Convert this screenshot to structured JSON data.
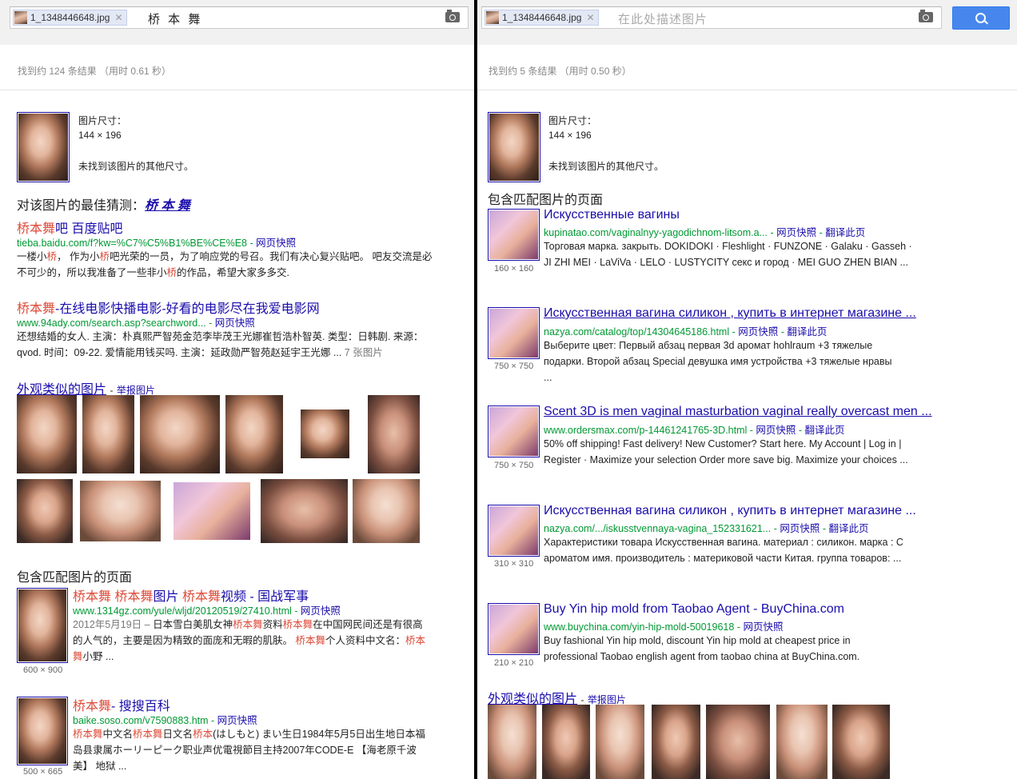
{
  "left": {
    "chip_filename": "1_1348446648.jpg",
    "query": "桥 本 舞",
    "stats": "找到约 124 条结果 （用时 0.61 秒）",
    "image_size_label": "图片尺寸：",
    "image_size": "144 × 196",
    "no_other_sizes": "未找到该图片的其他尺寸。",
    "best_guess_label": "对该图片的最佳猜测：",
    "best_guess_value": "桥 本 舞",
    "results": [
      {
        "title_parts": [
          [
            "桥本舞",
            true
          ],
          [
            "吧 百度贴吧",
            false
          ]
        ],
        "url": "tieba.baidu.com/f?kw=%C7%C5%B1%BE%CE%E8",
        "links": [
          "网页快照"
        ],
        "snippet_parts": [
          [
            "一楼小",
            false
          ],
          [
            "桥",
            true
          ],
          [
            "， 作为小",
            false
          ],
          [
            "桥",
            true
          ],
          [
            "吧光荣的一员，为了响应党的号召。我们有决心复兴贴吧。 吧友交流是必不可少的，所以我准备了一些非小",
            false
          ],
          [
            "桥",
            true
          ],
          [
            "的作品，希望大家多多交.",
            false
          ]
        ]
      },
      {
        "title_parts": [
          [
            "桥本舞",
            true
          ],
          [
            "-在线电影快播电影-好看的电影尽在我爱电影网",
            false
          ]
        ],
        "url": "www.94ady.com/search.asp?searchword...",
        "links": [
          "网页快照"
        ],
        "snippet_parts": [
          [
            "还想结婚的女人. 主演：朴真熙严智苑金范李毕茂王光娜崔哲浩朴智英. 类型：日韩剧. 来源：qvod. 时间：09-22. 爱情能用钱买吗. 主演：延政勋严智苑赵延宇王光娜 ...",
            false
          ]
        ],
        "extra": "7 张图片"
      }
    ],
    "similar_label": "外观类似的图片",
    "report_label": "举报图片",
    "matching_label": "包含匹配图片的页面",
    "matches": [
      {
        "size": "600 × 900",
        "title_parts": [
          [
            "桥本舞",
            true
          ],
          [
            " ",
            false
          ],
          [
            "桥本舞",
            true
          ],
          [
            "图片 ",
            false
          ],
          [
            "桥本舞",
            true
          ],
          [
            "视频 - 国战军事",
            false
          ]
        ],
        "url": "www.1314gz.com/yule/wljd/20120519/27410.html",
        "links": [
          "网页快照"
        ],
        "snippet_parts": [
          [
            "2012年5月19日 – ",
            false
          ],
          [
            "日本雪白美肌女神",
            false
          ],
          [
            "桥本舞",
            true
          ],
          [
            "资料",
            false
          ],
          [
            "桥本舞",
            true
          ],
          [
            "在中国网民间还是有很高的人气的，主要是因为精致的面庞和无暇的肌肤。 ",
            false
          ],
          [
            "桥本舞",
            true
          ],
          [
            "个人资料中文名：",
            false
          ],
          [
            "桥本舞",
            true
          ],
          [
            "小野 ...",
            false
          ]
        ]
      },
      {
        "size": "500 × 665",
        "title_parts": [
          [
            "桥本舞",
            true
          ],
          [
            "- 搜搜百科",
            false
          ]
        ],
        "url": "baike.soso.com/v7590883.htm",
        "links": [
          "网页快照"
        ],
        "snippet_parts": [
          [
            "桥本舞",
            true
          ],
          [
            "中文名",
            false
          ],
          [
            "桥本舞",
            true
          ],
          [
            "日文名",
            false
          ],
          [
            "桥本",
            true
          ],
          [
            "(はしもと) まい生日1984年5月5日出生地日本福岛县隶属ホーリーピーク职业声优電視節目主持2007年CODE-E 【海老原千波美】 地狱 ...",
            false
          ]
        ]
      }
    ]
  },
  "right": {
    "chip_filename": "1_1348446648.jpg",
    "placeholder": "在此处描述图片",
    "stats": "找到约 5 条结果 （用时 0.50 秒）",
    "image_size_label": "图片尺寸：",
    "image_size": "144 × 196",
    "no_other_sizes": "未找到该图片的其他尺寸。",
    "matching_label": "包含匹配图片的页面",
    "results": [
      {
        "size": "160 × 160",
        "title": "Искусственные вагины",
        "url": "kupinatao.com/vaginalnyy-yagodichnom-litsom.a...",
        "links": [
          "网页快照",
          "翻译此页"
        ],
        "snippet": "Торговая марка. закрыть. DOKIDOKI · Fleshlight · FUNZONE · Galaku · Gasseh · JI ZHI MEI · LaViVa · LELO · LUSTYCITY секс и город · MEI GUO ZHEN BIAN ..."
      },
      {
        "size": "750 × 750",
        "title": "Искусственная вагина силикон , купить в интернет магазине ...",
        "url": "nazya.com/catalog/top/14304645186.html",
        "links": [
          "网页快照",
          "翻译此页"
        ],
        "snippet": "Выберите цвет: Первый абзац первая 3d аромат hohlraum +3 тяжелые подарки. Второй абзац Special девушка имя устройства +3 тяжелые нравы ..."
      },
      {
        "size": "750 × 750",
        "title": "Scent 3D is men vaginal masturbation vaginal really overcast men ...",
        "url": "www.ordersmax.com/p-14461241765-3D.html",
        "links": [
          "网页快照",
          "翻译此页"
        ],
        "snippet": "50% off shipping! Fast delivery! New Customer? Start here. My Account | Log in | Register · Maximize your selection Order more save big. Maximize your choices ..."
      },
      {
        "size": "310 × 310",
        "title": "Искусственная вагина силикон , купить в интернет магазине ...",
        "url": "nazya.com/.../iskusstvennaya-vagina_152331621...",
        "links": [
          "网页快照",
          "翻译此页"
        ],
        "snippet": "Характеристики товара Искусственная вагина. материал : силикон. марка : С ароматом имя. производитель : материковой части Китая. группа товаров: ..."
      },
      {
        "size": "210 × 210",
        "title": "Buy Yin hip mold from Taobao Agent - BuyChina.com",
        "url": "www.buychina.com/yin-hip-mold-50019618",
        "links": [
          "网页快照"
        ],
        "snippet": "Buy fashional Yin hip mold, discount Yin hip mold at cheapest price in professional Taobao english agent from taobao china at BuyChina.com."
      }
    ],
    "similar_label": "外观类似的图片",
    "report_label": "举报图片"
  }
}
